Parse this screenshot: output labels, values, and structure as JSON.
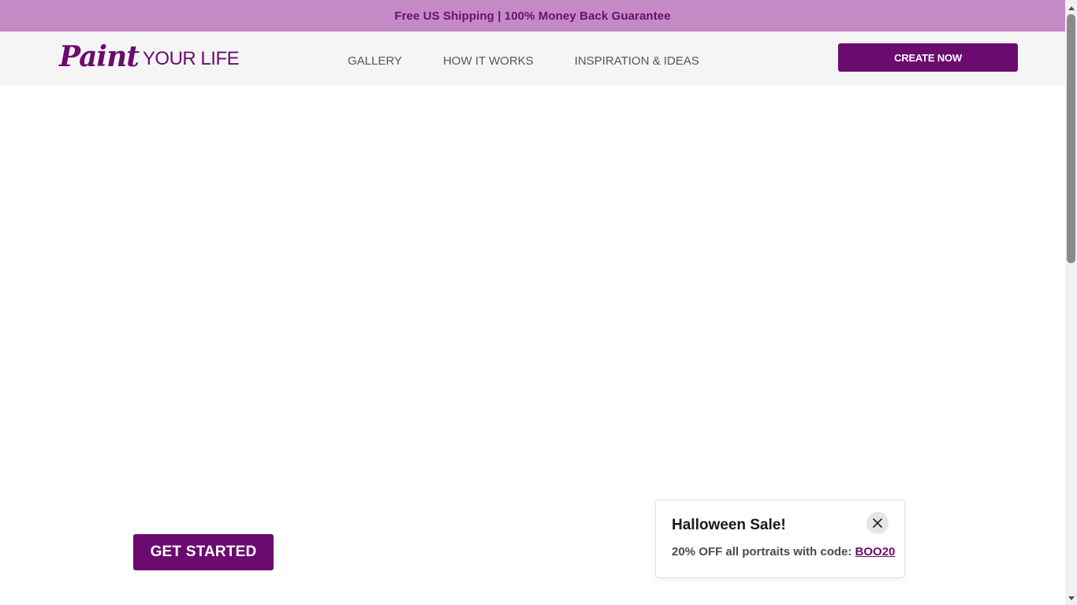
{
  "promo_bar": {
    "text": "Free US Shipping | 100% Money Back Guarantee"
  },
  "header": {
    "logo_script": "Paint",
    "logo_text": "YOUR LIFE",
    "nav": [
      {
        "label": "GALLERY"
      },
      {
        "label": "HOW IT WORKS"
      },
      {
        "label": "INSPIRATION & IDEAS"
      }
    ],
    "cta_label": "CREATE NOW"
  },
  "hero": {
    "get_started_label": "GET STARTED"
  },
  "toast": {
    "title": "Halloween Sale!",
    "body_prefix": "20% OFF all portraits with code: ",
    "code": "BOO20",
    "close_icon": "close-icon"
  },
  "colors": {
    "brand": "#6b0b70",
    "promo_bar_bg": "#c48ac6",
    "header_bg": "#f5f5f5"
  },
  "scrollbar": {
    "thumb_position_fraction": 0.0
  }
}
